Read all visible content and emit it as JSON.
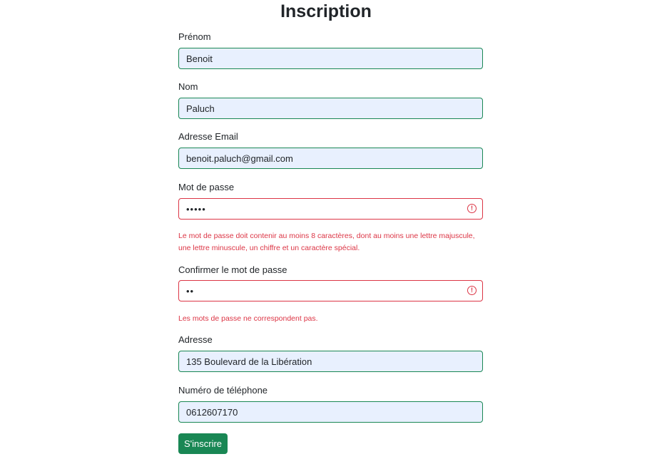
{
  "form": {
    "title": "Inscription",
    "first_name": {
      "label": "Prénom",
      "value": "Benoit"
    },
    "last_name": {
      "label": "Nom",
      "value": "Paluch"
    },
    "email": {
      "label": "Adresse Email",
      "value": "benoit.paluch@gmail.com"
    },
    "password": {
      "label": "Mot de passe",
      "value": "•••••",
      "error": "Le mot de passe doit contenir au moins 8 caractères, dont au moins une lettre majuscule, une lettre minuscule, un chiffre et un caractère spécial."
    },
    "confirm_password": {
      "label": "Confirmer le mot de passe",
      "value": "••",
      "error": "Les mots de passe ne correspondent pas."
    },
    "address": {
      "label": "Adresse",
      "value": "135 Boulevard de la Libération"
    },
    "phone": {
      "label": "Numéro de téléphone",
      "value": "0612607170"
    },
    "submit_label": "S'inscrire"
  },
  "icons": {
    "error_icon": "exclamation-circle-icon",
    "error_glyph": "!"
  },
  "colors": {
    "valid_border": "#198754",
    "invalid_border": "#dc3545",
    "autofill_bg": "#e8f0fe",
    "button_bg": "#198754",
    "error_text": "#dc3545"
  }
}
